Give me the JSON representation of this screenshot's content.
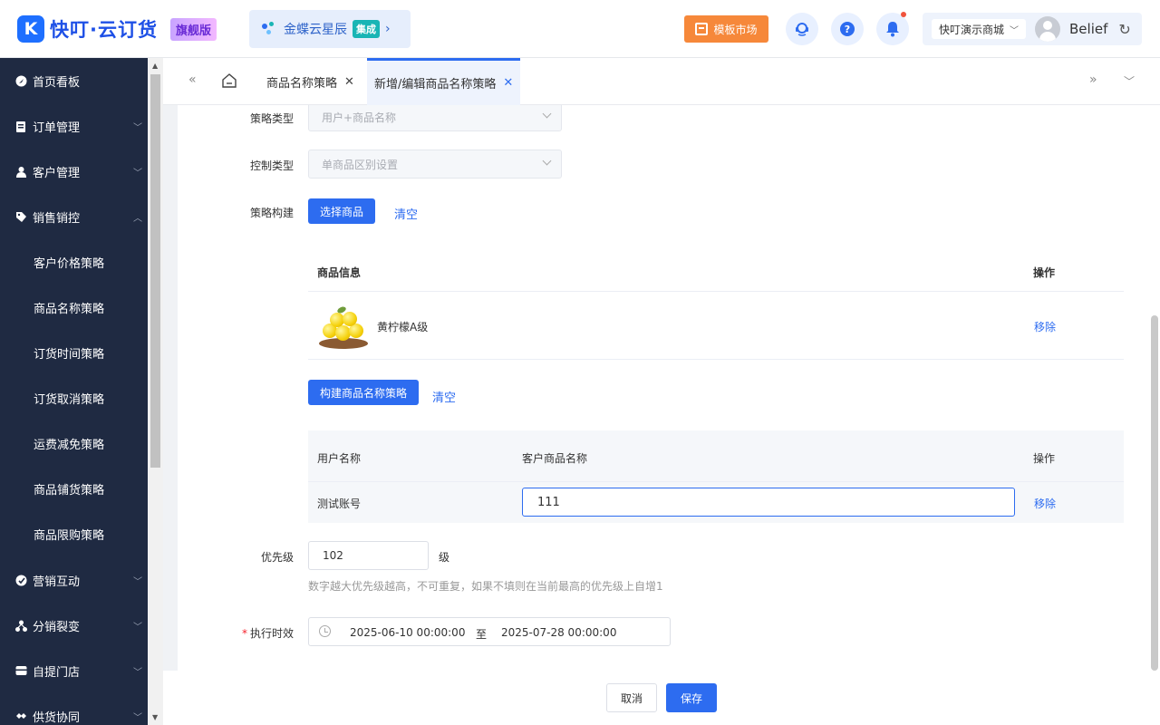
{
  "header": {
    "logo_text": "快叮·云订货",
    "edition_badge": "旗舰版",
    "partner_name": "金蝶云星辰",
    "partner_tag": "集成",
    "market_label": "模板市场",
    "store_name": "快叮演示商城",
    "user_name": "Belief"
  },
  "sidebar": {
    "items": [
      {
        "label": "首页看板",
        "icon": "dashboard-icon",
        "expandable": false
      },
      {
        "label": "订单管理",
        "icon": "order-icon",
        "expandable": true
      },
      {
        "label": "客户管理",
        "icon": "customer-icon",
        "expandable": true
      },
      {
        "label": "销售销控",
        "icon": "tag-icon",
        "expandable": true,
        "expanded": true
      },
      {
        "label": "营销互动",
        "icon": "marketing-icon",
        "expandable": true
      },
      {
        "label": "分销裂变",
        "icon": "distribution-icon",
        "expandable": true
      },
      {
        "label": "自提门店",
        "icon": "store-icon",
        "expandable": true
      },
      {
        "label": "供货协同",
        "icon": "supply-icon",
        "expandable": true
      }
    ],
    "subitems": [
      "客户价格策略",
      "商品名称策略",
      "订货时间策略",
      "订货取消策略",
      "运费减免策略",
      "商品铺货策略",
      "商品限购策略"
    ]
  },
  "tabs": [
    {
      "label": "商品名称策略",
      "active": false
    },
    {
      "label": "新增/编辑商品名称策略",
      "active": true
    }
  ],
  "form": {
    "strategy_type_label": "策略类型",
    "strategy_type_value": "用户+商品名称",
    "control_type_label": "控制类型",
    "control_type_value": "单商品区别设置",
    "build_label": "策略构建",
    "select_goods_button": "选择商品",
    "clear_link_1": "清空",
    "goods_table": {
      "header_info": "商品信息",
      "header_action": "操作",
      "rows": [
        {
          "name": "黄柠檬A级",
          "action": "移除"
        }
      ]
    },
    "build_name_button": "构建商品名称策略",
    "clear_link_2": "清空",
    "name_table": {
      "header_user": "用户名称",
      "header_custom_name": "客户商品名称",
      "header_action": "操作",
      "rows": [
        {
          "user": "测试账号",
          "custom_name": "111",
          "action": "移除"
        }
      ]
    },
    "priority_label": "优先级",
    "priority_value": "102",
    "priority_unit": "级",
    "priority_hint": "数字越大优先级越高，不可重复，如果不填则在当前最高的优先级上自增1",
    "exec_time_label": "执行时效",
    "exec_start": "2025-06-10 00:00:00",
    "exec_sep": "至",
    "exec_end": "2025-07-28 00:00:00"
  },
  "footer": {
    "cancel_label": "取消",
    "save_label": "保存"
  },
  "colors": {
    "primary": "#2d6cf0",
    "sidebar_bg": "#1f2a42",
    "market_orange": "#f6883a"
  }
}
